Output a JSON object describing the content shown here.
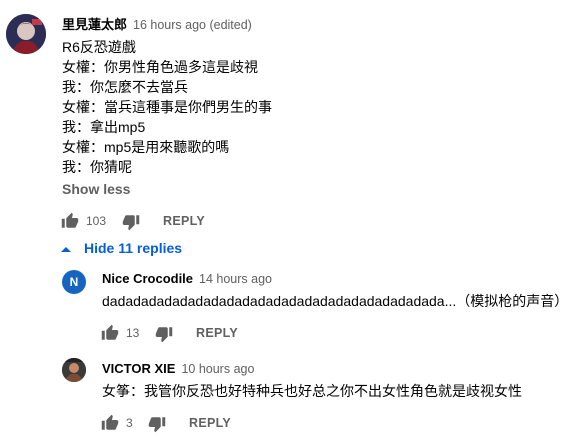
{
  "comment": {
    "author": "里見蓮太郎",
    "time": "16 hours ago (edited)",
    "lines": [
      "R6反恐遊戲",
      "女權：你男性角色過多這是歧視",
      "我：你怎麼不去當兵",
      "女權：當兵這種事是你們男生的事",
      "我：拿出mp5",
      "女權：mp5是用來聽歌的嗎",
      "我：你猜呢"
    ],
    "show_less": "Show less",
    "like_count": "103",
    "reply_label": "REPLY",
    "hide_replies": "Hide 11 replies"
  },
  "replies": [
    {
      "avatar_letter": "N",
      "author": "Nice Crocodile",
      "time": "14 hours ago",
      "text": "dadadadadadadadadadadadadadadadadadadadadada...（模拟枪的声音）",
      "like_count": "13",
      "reply_label": "REPLY"
    },
    {
      "author": "VICTOR XIE",
      "time": "10 hours ago",
      "text": "女筝：我管你反恐也好特种兵也好总之你不出女性角色就是歧视女性",
      "like_count": "3",
      "reply_label": "REPLY"
    }
  ],
  "icons": {
    "like": "thumbs-up-icon",
    "dislike": "thumbs-down-icon",
    "collapse": "caret-up-icon"
  },
  "colors": {
    "link_blue": "#065fd4",
    "secondary_text": "#606060",
    "avatar_n": "#1565c0"
  }
}
